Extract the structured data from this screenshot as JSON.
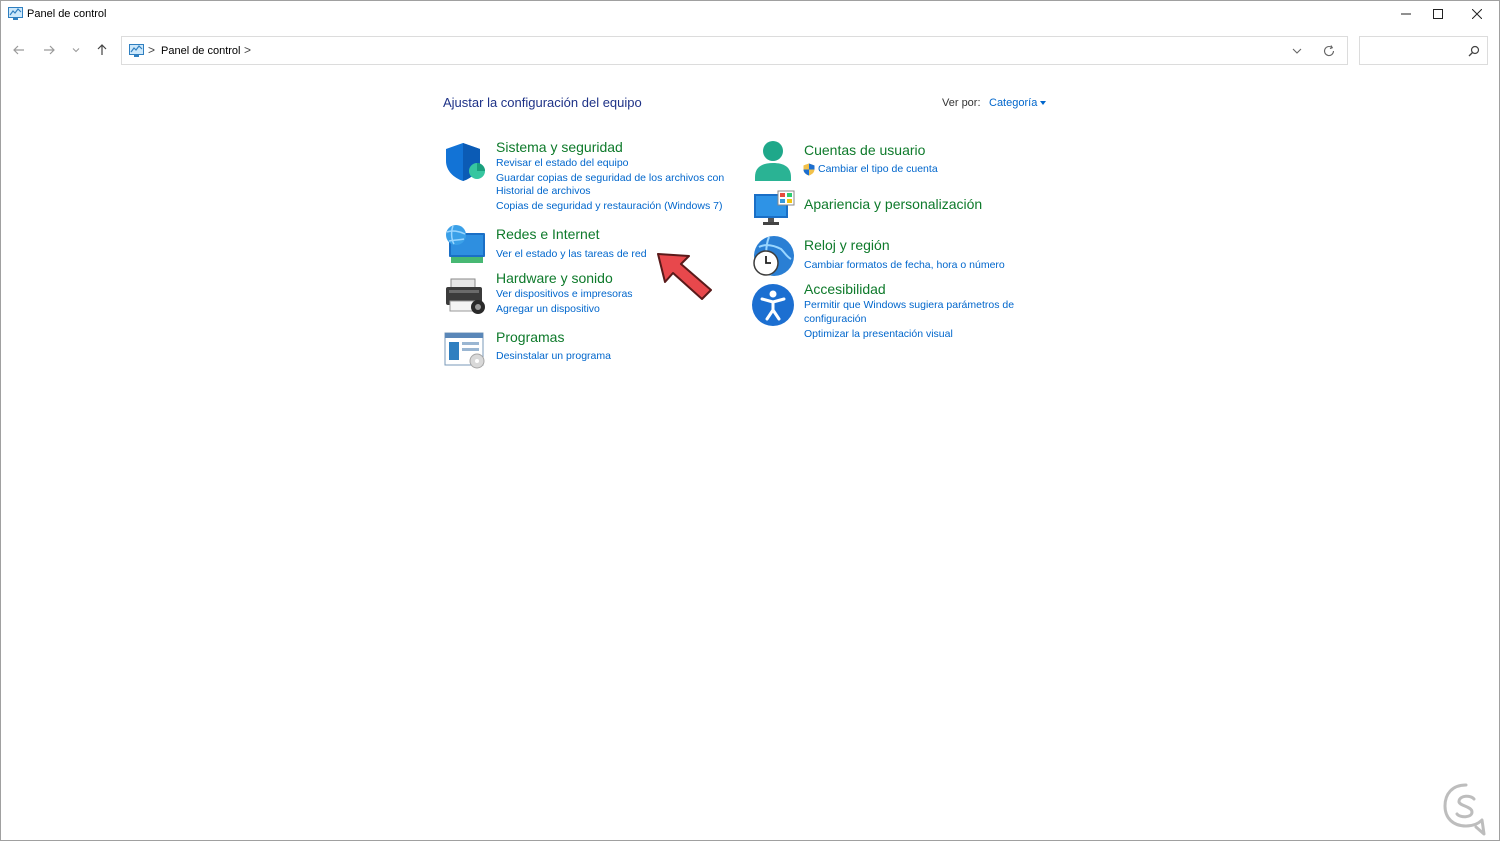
{
  "window": {
    "title": "Panel de control"
  },
  "address_bar": {
    "crumb": "Panel de control",
    "separator": ">"
  },
  "search": {
    "placeholder": ""
  },
  "main": {
    "heading": "Ajustar la configuración del equipo",
    "view_by_label": "Ver por:",
    "view_by_value": "Categoría"
  },
  "categories": {
    "sistema": {
      "title": "Sistema y seguridad",
      "links": [
        "Revisar el estado del equipo",
        "Guardar copias de seguridad de los archivos con",
        "Historial de archivos",
        "Copias de seguridad y restauración (Windows 7)"
      ]
    },
    "redes": {
      "title": "Redes e Internet",
      "links": [
        "Ver el estado y las tareas de red"
      ]
    },
    "hardware": {
      "title": "Hardware y sonido",
      "links": [
        "Ver dispositivos e impresoras",
        "Agregar un dispositivo"
      ]
    },
    "programas": {
      "title": "Programas",
      "links": [
        "Desinstalar un programa"
      ]
    },
    "cuentas": {
      "title": "Cuentas de usuario",
      "links": [
        "Cambiar el tipo de cuenta"
      ]
    },
    "apariencia": {
      "title": "Apariencia y personalización",
      "links": []
    },
    "reloj": {
      "title": "Reloj y región",
      "links": [
        "Cambiar formatos de fecha, hora o número"
      ]
    },
    "accesibilidad": {
      "title": "Accesibilidad",
      "links": [
        "Permitir que Windows sugiera parámetros de",
        "configuración",
        "Optimizar la presentación visual"
      ]
    }
  },
  "icons": {
    "sistema": "shield-icon",
    "redes": "network-globe-icon",
    "hardware": "printer-icon",
    "programas": "programs-icon",
    "cuentas": "user-icon",
    "apariencia": "monitor-personalize-icon",
    "reloj": "globe-clock-icon",
    "accesibilidad": "accessibility-icon",
    "uac": "uac-shield-icon"
  },
  "colors": {
    "category_title": "#0e7a2b",
    "link": "#0066cc",
    "heading": "#1e3287",
    "annotation_arrow": "#e8484c"
  }
}
